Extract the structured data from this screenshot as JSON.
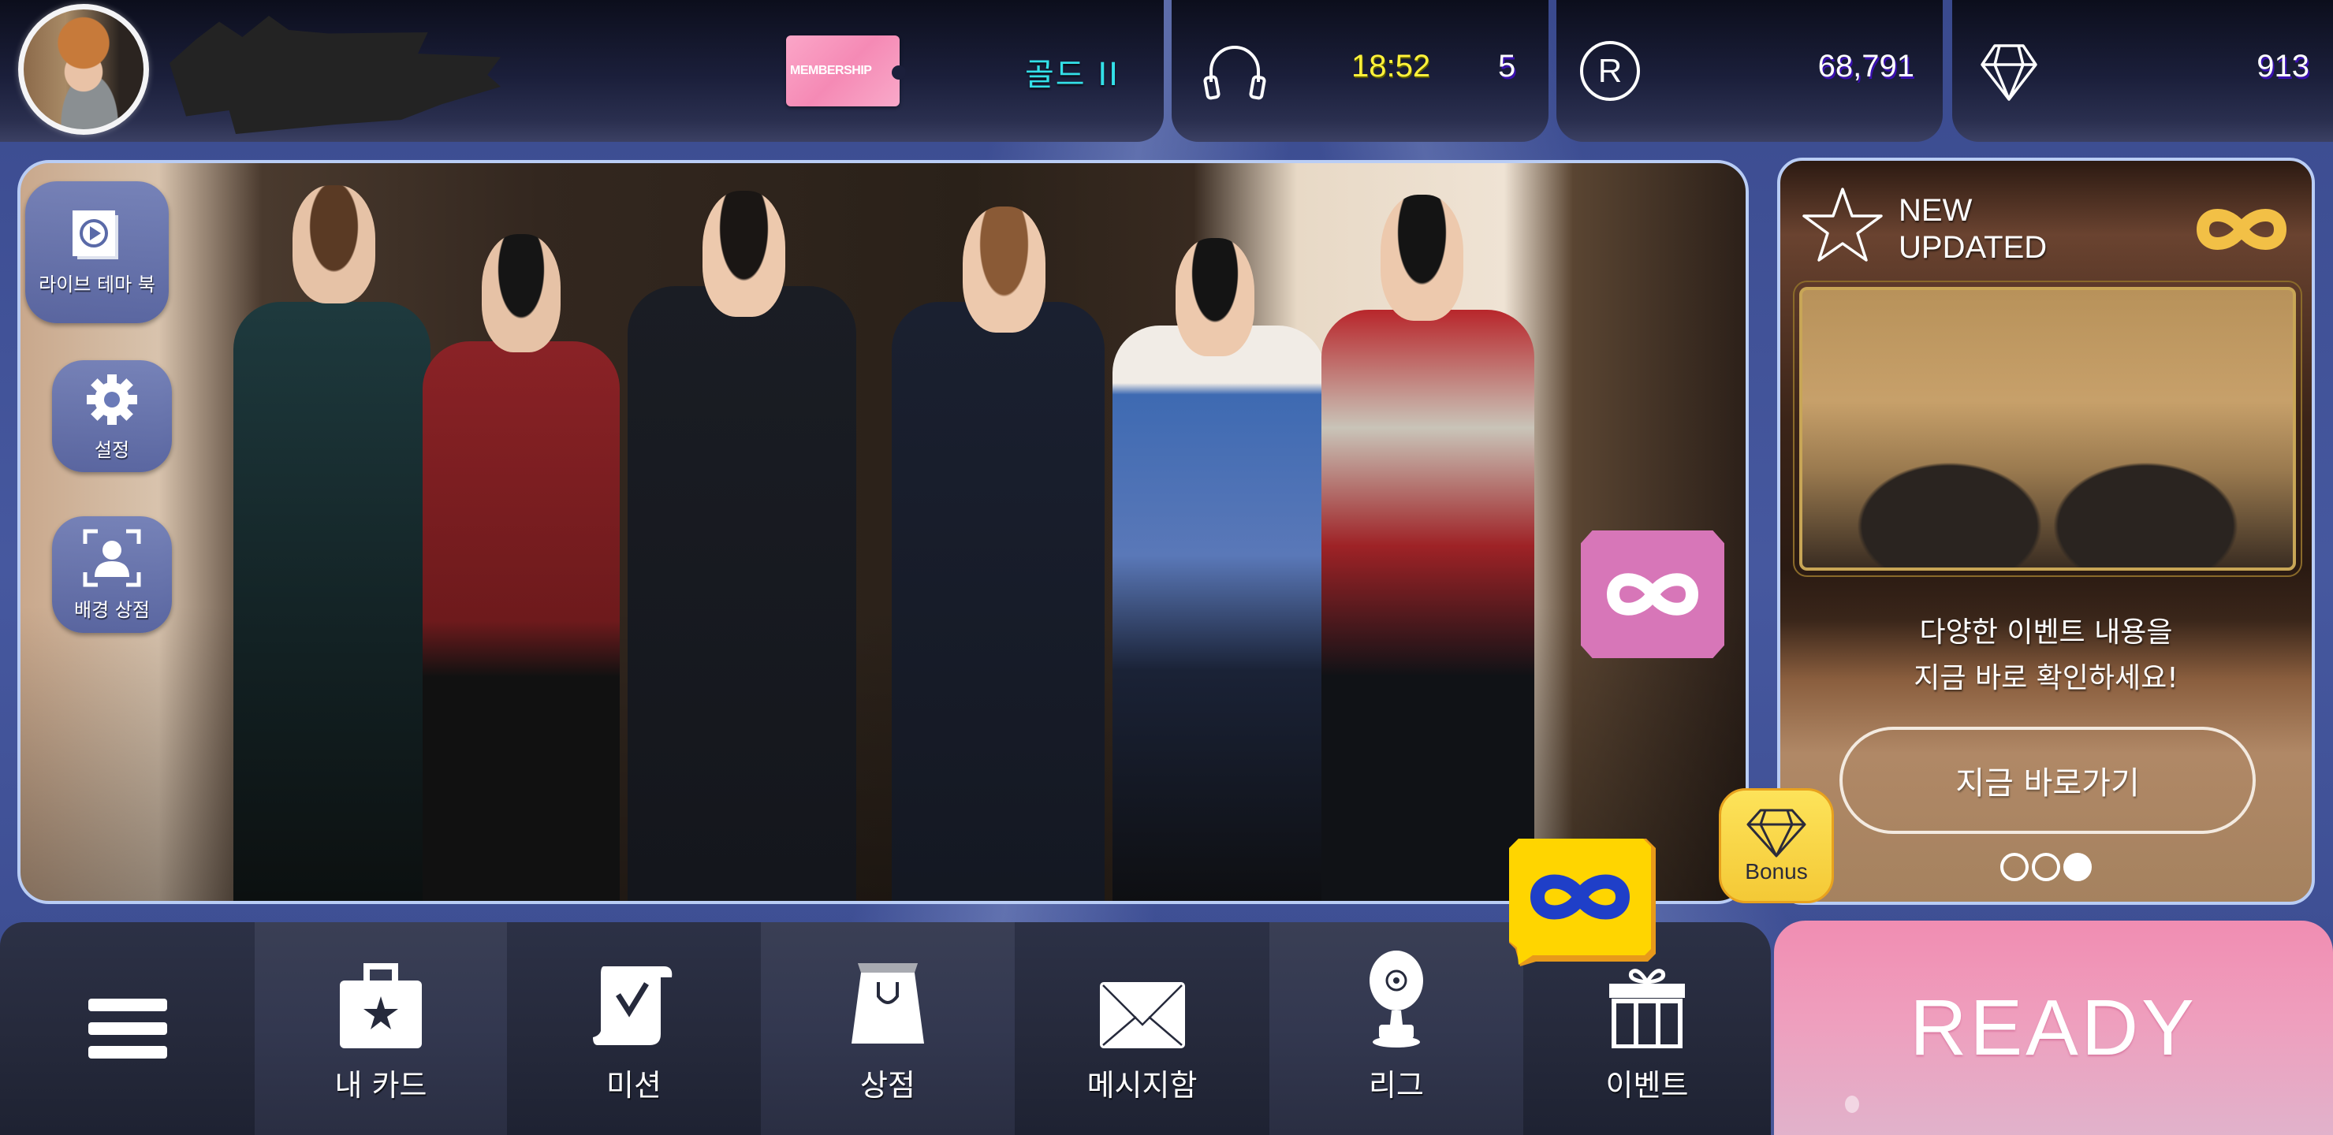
{
  "header": {
    "avatar": "user-avatar",
    "username": "",
    "membership_label": "MEMBERSHIP",
    "rank": "골드 II",
    "music": {
      "icon": "headphones-icon",
      "timer": "18:52",
      "count": "5"
    },
    "ruby": {
      "icon": "r-coin-icon",
      "value": "68,791"
    },
    "gem": {
      "icon": "diamond-icon",
      "value": "913"
    }
  },
  "side_buttons": [
    {
      "icon": "play-book-icon",
      "label": "라이브 테마 북"
    },
    {
      "icon": "gear-icon",
      "label": "설정"
    },
    {
      "icon": "portrait-frame-icon",
      "label": "배경 상점"
    }
  ],
  "event_panel": {
    "title_line1": "NEW",
    "title_line2": "UPDATED",
    "description_line1": "다양한 이벤트 내용을",
    "description_line2": "지금 바로 확인하세요!",
    "cta_label": "지금 바로가기",
    "pager": {
      "total": 3,
      "active": 3
    }
  },
  "bonus_badge": {
    "label": "Bonus"
  },
  "bottom_nav": [
    {
      "icon": "menu-icon",
      "label": ""
    },
    {
      "icon": "card-bag-icon",
      "label": "내 카드"
    },
    {
      "icon": "mission-scroll-icon",
      "label": "미션"
    },
    {
      "icon": "shopping-bag-icon",
      "label": "상점"
    },
    {
      "icon": "envelope-icon",
      "label": "메시지함"
    },
    {
      "icon": "trophy-disc-icon",
      "label": "리그"
    },
    {
      "icon": "gift-icon",
      "label": "이벤트"
    }
  ],
  "ready_button": {
    "label": "READY"
  },
  "colors": {
    "rank_text": "#33e0e8",
    "timer_text": "#fff23a",
    "ready_pink": "#f08db2",
    "infinity_pink": "#d776b8",
    "infinity_yellow": "#ffd500",
    "infinity_blue": "#1f3fc8",
    "accent_blue": "#46589f"
  }
}
